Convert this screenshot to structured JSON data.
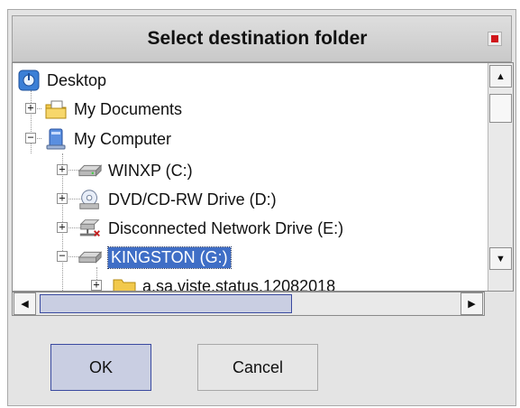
{
  "dialog": {
    "title": "Select destination folder",
    "ok_label": "OK",
    "cancel_label": "Cancel"
  },
  "tree": {
    "nodes": [
      {
        "label": "Desktop",
        "icon": "desktop-icon"
      },
      {
        "label": "My Documents",
        "icon": "documents-folder-icon"
      },
      {
        "label": "My Computer",
        "icon": "computer-icon"
      },
      {
        "label": "WINXP (C:)",
        "icon": "hard-drive-icon"
      },
      {
        "label": "DVD/CD-RW Drive (D:)",
        "icon": "cd-drive-icon"
      },
      {
        "label": "Disconnected Network Drive (E:)",
        "icon": "network-drive-icon"
      },
      {
        "label": "KINGSTON (G:)",
        "icon": "usb-drive-icon",
        "selected": true
      },
      {
        "label": "a.sa.viste.status.12082018",
        "icon": "folder-icon"
      }
    ]
  },
  "colors": {
    "selection": "#3f6ec6",
    "close": "#d0161b"
  }
}
